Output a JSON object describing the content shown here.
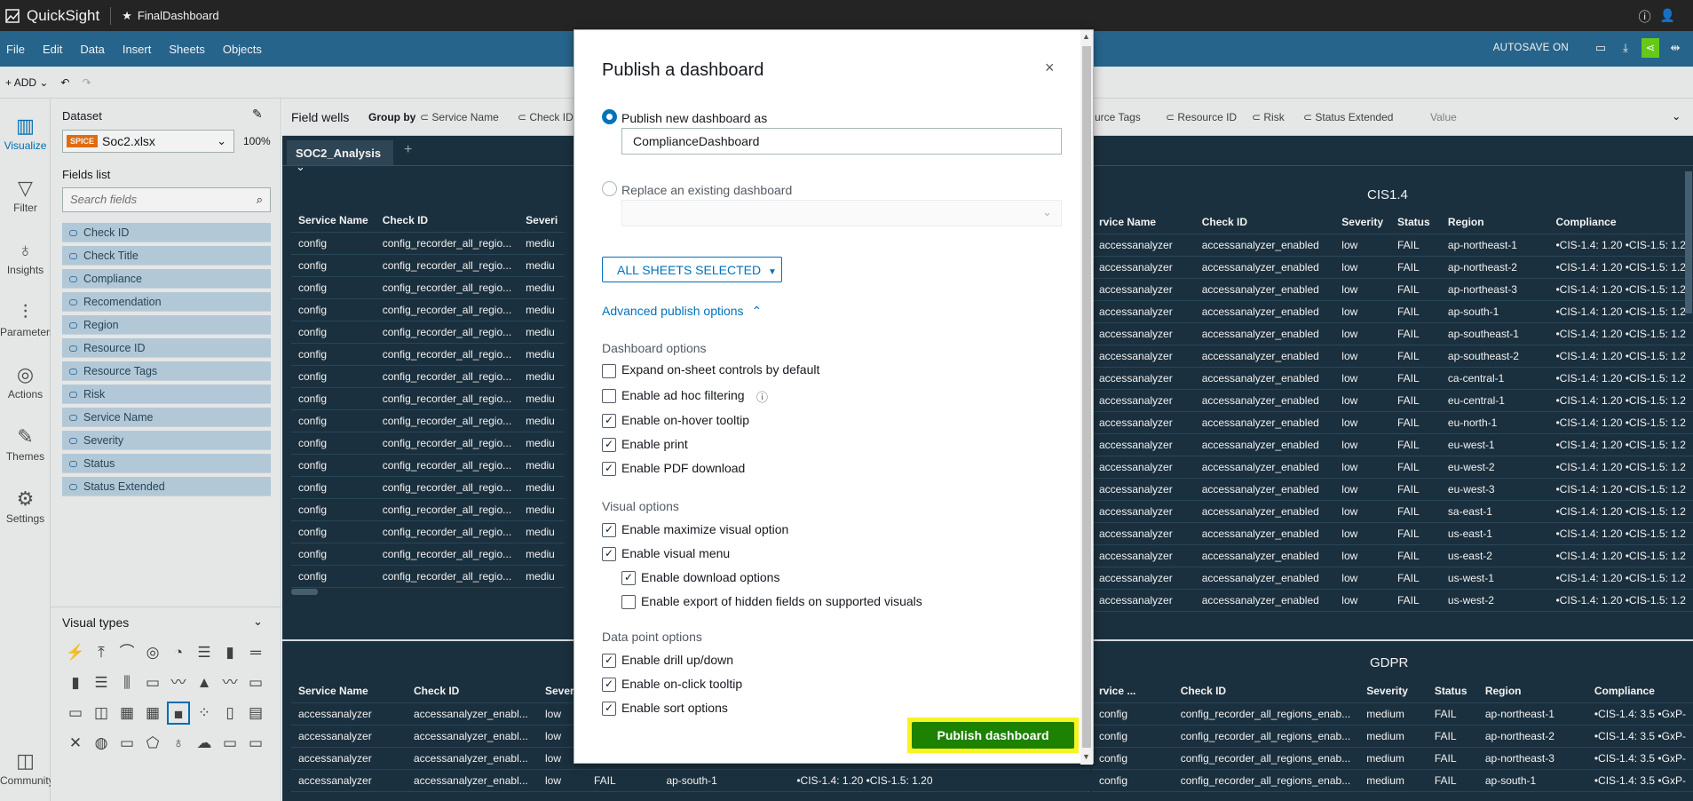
{
  "topbar": {
    "app_name": "QuickSight",
    "dashboard_name": "FinalDashboard"
  },
  "menu": {
    "items": [
      "File",
      "Edit",
      "Data",
      "Insert",
      "Sheets",
      "Objects"
    ],
    "autosave": "AUTOSAVE ON"
  },
  "toolbar": {
    "add_label": "ADD"
  },
  "rail": [
    "Visualize",
    "Filter",
    "Insights",
    "Parameters",
    "Actions",
    "Themes",
    "Settings",
    "Community"
  ],
  "dataset": {
    "label": "Dataset",
    "badge": "SPICE",
    "name": "Soc2.xlsx",
    "percent": "100%",
    "fields_label": "Fields list",
    "search_placeholder": "Search fields"
  },
  "fields": [
    "Check ID",
    "Check Title",
    "Compliance",
    "Recomendation",
    "Region",
    "Resource ID",
    "Resource Tags",
    "Risk",
    "Service Name",
    "Severity",
    "Status",
    "Status Extended"
  ],
  "visual_types_label": "Visual types",
  "wells": {
    "title": "Field wells",
    "group_by": "Group by",
    "chips_left": [
      "Service Name",
      "Check ID"
    ],
    "chips_right_partial": "urce Tags",
    "chips_right": [
      "Resource ID",
      "Risk",
      "Status Extended"
    ],
    "value": "Value"
  },
  "sheet_tab": "SOC2_Analysis",
  "left_table": {
    "headers": [
      "Service Name",
      "Check ID",
      "Severi"
    ],
    "rows": [
      [
        "config",
        "config_recorder_all_regio...",
        "mediu"
      ],
      [
        "config",
        "config_recorder_all_regio...",
        "mediu"
      ],
      [
        "config",
        "config_recorder_all_regio...",
        "mediu"
      ],
      [
        "config",
        "config_recorder_all_regio...",
        "mediu"
      ],
      [
        "config",
        "config_recorder_all_regio...",
        "mediu"
      ],
      [
        "config",
        "config_recorder_all_regio...",
        "mediu"
      ],
      [
        "config",
        "config_recorder_all_regio...",
        "mediu"
      ],
      [
        "config",
        "config_recorder_all_regio...",
        "mediu"
      ],
      [
        "config",
        "config_recorder_all_regio...",
        "mediu"
      ],
      [
        "config",
        "config_recorder_all_regio...",
        "mediu"
      ],
      [
        "config",
        "config_recorder_all_regio...",
        "mediu"
      ],
      [
        "config",
        "config_recorder_all_regio...",
        "mediu"
      ],
      [
        "config",
        "config_recorder_all_regio...",
        "mediu"
      ],
      [
        "config",
        "config_recorder_all_regio...",
        "mediu"
      ],
      [
        "config",
        "config_recorder_all_regio...",
        "mediu"
      ],
      [
        "config",
        "config_recorder_all_regio...",
        "mediu"
      ]
    ]
  },
  "cis_table": {
    "title": "CIS1.4",
    "headers": [
      "rvice Name",
      "Check ID",
      "Severity",
      "Status",
      "Region",
      "Compliance"
    ],
    "rows": [
      [
        "accessanalyzer",
        "accessanalyzer_enabled",
        "low",
        "FAIL",
        "ap-northeast-1",
        "•CIS-1.4: 1.20 •CIS-1.5: 1.2"
      ],
      [
        "accessanalyzer",
        "accessanalyzer_enabled",
        "low",
        "FAIL",
        "ap-northeast-2",
        "•CIS-1.4: 1.20 •CIS-1.5: 1.2"
      ],
      [
        "accessanalyzer",
        "accessanalyzer_enabled",
        "low",
        "FAIL",
        "ap-northeast-3",
        "•CIS-1.4: 1.20 •CIS-1.5: 1.2"
      ],
      [
        "accessanalyzer",
        "accessanalyzer_enabled",
        "low",
        "FAIL",
        "ap-south-1",
        "•CIS-1.4: 1.20 •CIS-1.5: 1.2"
      ],
      [
        "accessanalyzer",
        "accessanalyzer_enabled",
        "low",
        "FAIL",
        "ap-southeast-1",
        "•CIS-1.4: 1.20 •CIS-1.5: 1.2"
      ],
      [
        "accessanalyzer",
        "accessanalyzer_enabled",
        "low",
        "FAIL",
        "ap-southeast-2",
        "•CIS-1.4: 1.20 •CIS-1.5: 1.2"
      ],
      [
        "accessanalyzer",
        "accessanalyzer_enabled",
        "low",
        "FAIL",
        "ca-central-1",
        "•CIS-1.4: 1.20 •CIS-1.5: 1.2"
      ],
      [
        "accessanalyzer",
        "accessanalyzer_enabled",
        "low",
        "FAIL",
        "eu-central-1",
        "•CIS-1.4: 1.20 •CIS-1.5: 1.2"
      ],
      [
        "accessanalyzer",
        "accessanalyzer_enabled",
        "low",
        "FAIL",
        "eu-north-1",
        "•CIS-1.4: 1.20 •CIS-1.5: 1.2"
      ],
      [
        "accessanalyzer",
        "accessanalyzer_enabled",
        "low",
        "FAIL",
        "eu-west-1",
        "•CIS-1.4: 1.20 •CIS-1.5: 1.2"
      ],
      [
        "accessanalyzer",
        "accessanalyzer_enabled",
        "low",
        "FAIL",
        "eu-west-2",
        "•CIS-1.4: 1.20 •CIS-1.5: 1.2"
      ],
      [
        "accessanalyzer",
        "accessanalyzer_enabled",
        "low",
        "FAIL",
        "eu-west-3",
        "•CIS-1.4: 1.20 •CIS-1.5: 1.2"
      ],
      [
        "accessanalyzer",
        "accessanalyzer_enabled",
        "low",
        "FAIL",
        "sa-east-1",
        "•CIS-1.4: 1.20 •CIS-1.5: 1.2"
      ],
      [
        "accessanalyzer",
        "accessanalyzer_enabled",
        "low",
        "FAIL",
        "us-east-1",
        "•CIS-1.4: 1.20 •CIS-1.5: 1.2"
      ],
      [
        "accessanalyzer",
        "accessanalyzer_enabled",
        "low",
        "FAIL",
        "us-east-2",
        "•CIS-1.4: 1.20 •CIS-1.5: 1.2"
      ],
      [
        "accessanalyzer",
        "accessanalyzer_enabled",
        "low",
        "FAIL",
        "us-west-1",
        "•CIS-1.4: 1.20 •CIS-1.5: 1.2"
      ],
      [
        "accessanalyzer",
        "accessanalyzer_enabled",
        "low",
        "FAIL",
        "us-west-2",
        "•CIS-1.4: 1.20 •CIS-1.5: 1.2"
      ]
    ]
  },
  "bottom_left_table": {
    "headers": [
      "Service Name",
      "Check ID",
      "Severi"
    ],
    "rows": [
      [
        "accessanalyzer",
        "accessanalyzer_enabl...",
        "low"
      ],
      [
        "accessanalyzer",
        "accessanalyzer_enabl...",
        "low"
      ],
      [
        "accessanalyzer",
        "accessanalyzer_enabl...",
        "low"
      ],
      [
        "accessanalyzer",
        "accessanalyzer_enabl...",
        "low"
      ]
    ],
    "last_row_extra": [
      "FAIL",
      "ap-south-1",
      "•CIS-1.4: 1.20 •CIS-1.5: 1.20"
    ]
  },
  "gdpr_table": {
    "title": "GDPR",
    "headers": [
      "rvice ...",
      "Check ID",
      "Severity",
      "Status",
      "Region",
      "Compliance"
    ],
    "rows": [
      [
        "config",
        "config_recorder_all_regions_enab...",
        "medium",
        "FAIL",
        "ap-northeast-1",
        "•CIS-1.4: 3.5 •GxP-"
      ],
      [
        "config",
        "config_recorder_all_regions_enab...",
        "medium",
        "FAIL",
        "ap-northeast-2",
        "•CIS-1.4: 3.5 •GxP-"
      ],
      [
        "config",
        "config_recorder_all_regions_enab...",
        "medium",
        "FAIL",
        "ap-northeast-3",
        "•CIS-1.4: 3.5 •GxP-"
      ],
      [
        "config",
        "config_recorder_all_regions_enab...",
        "medium",
        "FAIL",
        "ap-south-1",
        "•CIS-1.4: 3.5 •GxP-"
      ]
    ]
  },
  "modal": {
    "title": "Publish a dashboard",
    "publish_new_label": "Publish new dashboard as",
    "dashboard_name_value": "ComplianceDashboard",
    "replace_label": "Replace an existing dashboard",
    "sheets_button": "ALL SHEETS SELECTED",
    "advanced_link": "Advanced publish options",
    "dashboard_options_title": "Dashboard options",
    "dashboard_options": [
      {
        "label": "Expand on-sheet controls by default",
        "checked": false
      },
      {
        "label": "Enable ad hoc filtering",
        "checked": false
      },
      {
        "label": "Enable on-hover tooltip",
        "checked": true
      },
      {
        "label": "Enable print",
        "checked": true
      },
      {
        "label": "Enable PDF download",
        "checked": true
      }
    ],
    "visual_options_title": "Visual options",
    "visual_options": [
      {
        "label": "Enable maximize visual option",
        "checked": true
      },
      {
        "label": "Enable visual menu",
        "checked": true
      },
      {
        "label": "Enable download options",
        "checked": true
      },
      {
        "label": "Enable export of hidden fields on supported visuals",
        "checked": false
      }
    ],
    "data_point_options_title": "Data point options",
    "data_point_options": [
      {
        "label": "Enable drill up/down",
        "checked": true
      },
      {
        "label": "Enable on-click tooltip",
        "checked": true
      },
      {
        "label": "Enable sort options",
        "checked": true
      }
    ],
    "publish_button": "Publish dashboard"
  }
}
